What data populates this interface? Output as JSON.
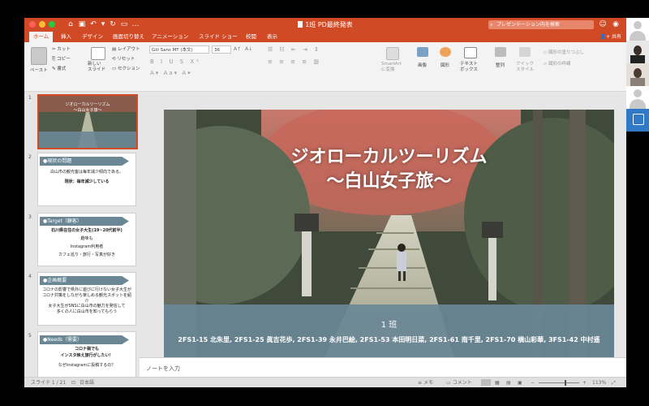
{
  "app": {
    "document_title": "1班 PD最終発表",
    "search_placeholder": "プレゼンテーション内を検索",
    "share_label": "共有"
  },
  "tabs": [
    "ホーム",
    "挿入",
    "デザイン",
    "画面切り替え",
    "アニメーション",
    "スライド ショー",
    "校閲",
    "表示"
  ],
  "ribbon": {
    "paste": "ペースト",
    "cut": "カット",
    "copy": "コピー",
    "format": "書式",
    "new_slide": "新しい\nスライド",
    "layout": "レイアウト",
    "reset": "リセット",
    "section": "セクション",
    "font_name": "Gill Sans MT (本文)",
    "font_size": "36",
    "smartart": "SmartArt\nに変換",
    "picture": "画像",
    "shape": "図形",
    "textbox": "テキスト\nボックス",
    "arrange": "整列",
    "quick_style": "クイック\nスタイル",
    "shape_fill": "図形の塗りつぶし",
    "shape_outline": "図形の枠線"
  },
  "slides": [
    {
      "num": "1",
      "title": "ジオローカルツーリズム",
      "subtitle": "〜白山女子旅〜"
    },
    {
      "num": "2",
      "header": "●現状の問題",
      "line1": "白山市の観光客は毎年減少傾向である。",
      "line2": "現状：毎年減少している"
    },
    {
      "num": "3",
      "header": "●Target（顧客）",
      "line1": "石川県在住の女子大生(19~20代前半)",
      "line2": "趣味も",
      "line3": "Instagram利用者",
      "line4": "カフェ巡り・旅行・写真が好き"
    },
    {
      "num": "4",
      "header": "●企画概要",
      "line1": "コロナの影響で県外に遊びに行けない女子大生が",
      "line2": "コロナ対策をしながら楽しめる観光スポットを紹介",
      "line3": "女子大生がSNSに白山市の魅力を発信して",
      "line4": "多くの人に白山市を知ってもらう"
    },
    {
      "num": "5",
      "header": "●Needs（需要）",
      "line1": "コロナ禍でも",
      "line2": "インスタ映え旅行がしたい！",
      "line3": "なぜInstagramに投稿するの？"
    }
  ],
  "main_slide": {
    "title": "ジオローカルツーリズム",
    "subtitle": "〜白山女子旅〜",
    "team": "1 班",
    "members": "2FS1-15 北朱里, 2FS1-25 眞吉花歩, 2FS1-39 永井巴絵, 2FS1-53 本田明日菜, 2FS1-61 南千里, 2FS1-70 横山彩華, 3FS1-42 中村遥"
  },
  "notes_placeholder": "ノートを入力",
  "status": {
    "slide_position": "スライド 1 / 21",
    "language": "日本語",
    "notes": "メモ",
    "comments": "コメント",
    "zoom": "113%"
  },
  "colors": {
    "accent": "#d04a26",
    "banner": "#6b8796",
    "slide_text": "#ffffff"
  }
}
